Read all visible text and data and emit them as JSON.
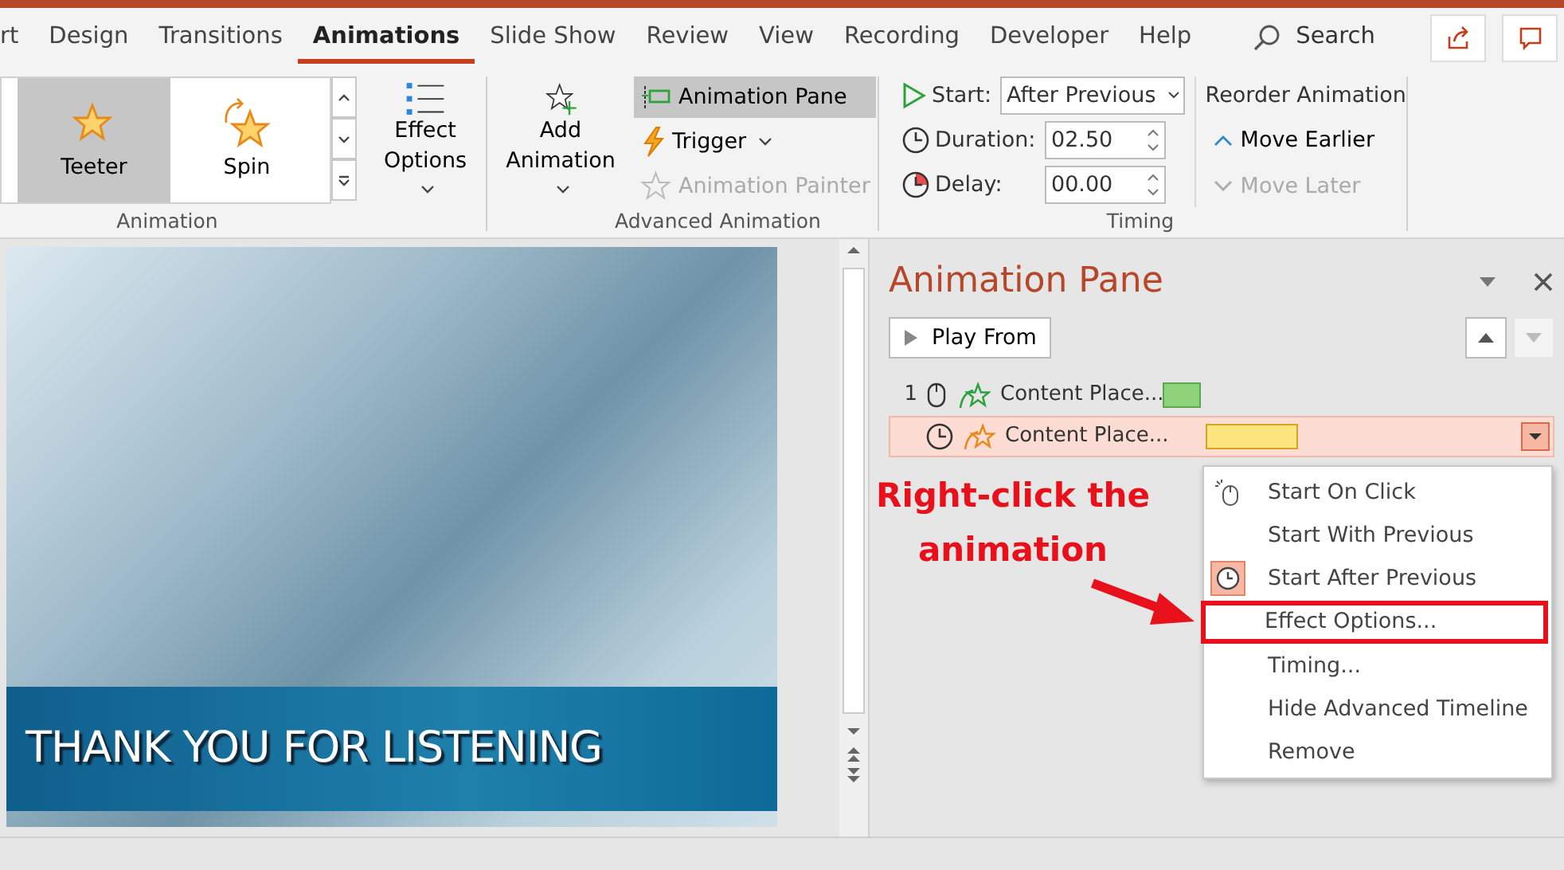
{
  "tabs": [
    {
      "label": "rt",
      "selected": false
    },
    {
      "label": "Design",
      "selected": false
    },
    {
      "label": "Transitions",
      "selected": false
    },
    {
      "label": "Animations",
      "selected": true
    },
    {
      "label": "Slide Show",
      "selected": false
    },
    {
      "label": "Review",
      "selected": false
    },
    {
      "label": "View",
      "selected": false
    },
    {
      "label": "Recording",
      "selected": false
    },
    {
      "label": "Developer",
      "selected": false
    },
    {
      "label": "Help",
      "selected": false
    }
  ],
  "search": {
    "label": "Search"
  },
  "ribbon": {
    "gallery": [
      {
        "label": "Teeter",
        "selected": true
      },
      {
        "label": "Spin",
        "selected": false
      }
    ],
    "effect_options": {
      "label": "Effect Options"
    },
    "add_animation": {
      "label": "Add Animation"
    },
    "advanced": [
      {
        "kind": "pane",
        "label": "Animation Pane",
        "selected": true,
        "disabled": false
      },
      {
        "kind": "trigger",
        "label": "Trigger",
        "selected": false,
        "disabled": false
      },
      {
        "kind": "painter",
        "label": "Animation Painter",
        "selected": false,
        "disabled": true
      }
    ],
    "groups": [
      {
        "label": "Animation"
      },
      {
        "label": "Advanced Animation"
      },
      {
        "label": "Timing"
      }
    ],
    "timing": {
      "start_label": "Start:",
      "start_value": "After Previous",
      "duration_label": "Duration:",
      "duration_value": "02.50",
      "delay_label": "Delay:",
      "delay_value": "00.00"
    },
    "reorder": {
      "title": "Reorder Animation",
      "items": [
        {
          "kind": "up",
          "label": "Move Earlier",
          "disabled": false
        },
        {
          "kind": "down",
          "label": "Move Later",
          "disabled": true
        }
      ]
    }
  },
  "slide": {
    "title": "THANK YOU FOR LISTENING"
  },
  "animation_pane": {
    "title": "Animation Pane",
    "play_button": "Play From",
    "items": [
      {
        "number": "1",
        "kind": "click",
        "label": "Content Place...",
        "color": "#8fd27a",
        "selected": false
      },
      {
        "kind": "after",
        "label": "Content Place...",
        "color": "#ffe57f",
        "selected": true
      }
    ]
  },
  "context_menu": {
    "items": [
      {
        "kind": "click",
        "label": "Start On Click",
        "checked": false,
        "boxed": false
      },
      {
        "kind": "with",
        "label": "Start With Previous",
        "checked": false,
        "boxed": false
      },
      {
        "kind": "after",
        "label": "Start After Previous",
        "checked": true,
        "boxed": false
      },
      {
        "kind": "plain",
        "label": "Effect Options...",
        "checked": false,
        "boxed": true
      },
      {
        "kind": "plain",
        "label": "Timing...",
        "checked": false,
        "boxed": false
      },
      {
        "kind": "plain",
        "label": "Hide Advanced Timeline",
        "checked": false,
        "boxed": false
      },
      {
        "kind": "plain",
        "label": "Remove",
        "checked": false,
        "boxed": false
      }
    ]
  },
  "annotation": {
    "text": "Right-click the animation"
  }
}
